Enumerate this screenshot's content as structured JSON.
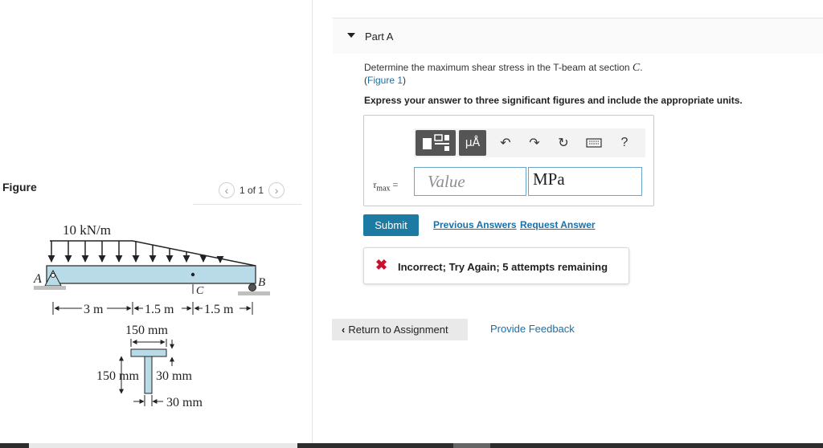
{
  "figure": {
    "heading": "Figure",
    "pager_text": "1 of 1",
    "prev_icon": "chevron-left-icon",
    "next_icon": "chevron-right-icon",
    "diagram": {
      "load_label": "10 kN/m",
      "support_a": "A",
      "support_b": "B",
      "section_label": "C",
      "dim_3m": "3 m",
      "dim_15m_1": "1.5 m",
      "dim_15m_2": "1.5 m",
      "flange_width": "150 mm",
      "web_height": "150 mm",
      "flange_thickness": "30 mm",
      "web_thickness": "30 mm"
    }
  },
  "part": {
    "title": "Part A",
    "question_prefix": "Determine the maximum shear stress in the T-beam at section ",
    "question_var": "C",
    "question_suffix": ".",
    "figure_link_open": "(",
    "figure_link": "Figure 1",
    "figure_link_close": ")",
    "instructions": "Express your answer to three significant figures and include the appropriate units."
  },
  "toolbar": {
    "units_label": "μÅ",
    "help_label": "?",
    "icons": [
      "templates-icon",
      "units-icon",
      "undo-icon",
      "redo-icon",
      "reset-icon",
      "keyboard-icon",
      "help-icon"
    ]
  },
  "answer": {
    "variable": "τ",
    "variable_sub": "max",
    "equals": "=",
    "value_placeholder": "Value",
    "units": "MPa"
  },
  "actions": {
    "submit": "Submit",
    "previous_answers": "Previous Answers",
    "request_answer": "Request Answer"
  },
  "feedback": {
    "icon": "x-icon",
    "text": "Incorrect; Try Again; 5 attempts remaining"
  },
  "footer": {
    "return": "Return to Assignment",
    "provide_feedback": "Provide Feedback"
  },
  "colors": {
    "accent": "#1c7aa3",
    "error": "#c8102e",
    "link": "#1a6fa8",
    "beam": "#b9dbe8"
  }
}
